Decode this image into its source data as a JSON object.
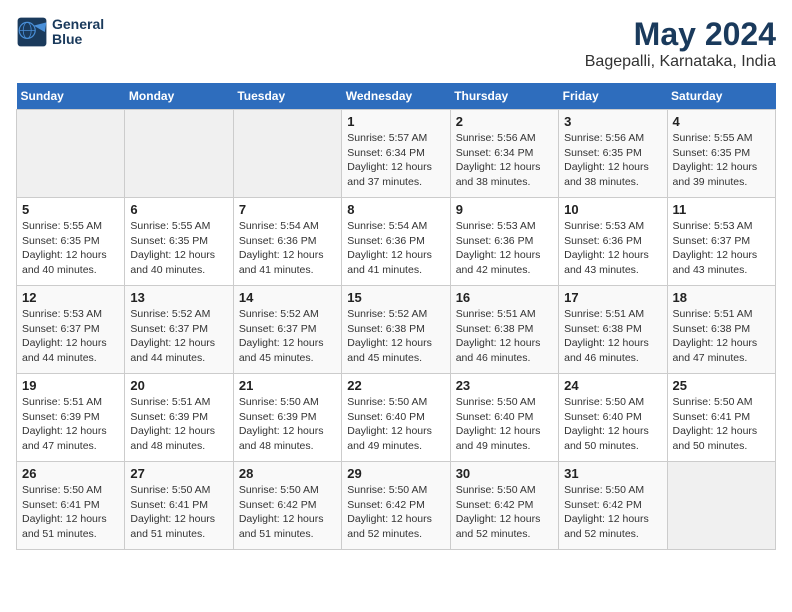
{
  "header": {
    "logo_line1": "General",
    "logo_line2": "Blue",
    "title": "May 2024",
    "subtitle": "Bagepalli, Karnataka, India"
  },
  "days_of_week": [
    "Sunday",
    "Monday",
    "Tuesday",
    "Wednesday",
    "Thursday",
    "Friday",
    "Saturday"
  ],
  "weeks": [
    [
      {
        "num": "",
        "info": ""
      },
      {
        "num": "",
        "info": ""
      },
      {
        "num": "",
        "info": ""
      },
      {
        "num": "1",
        "info": "Sunrise: 5:57 AM\nSunset: 6:34 PM\nDaylight: 12 hours and 37 minutes."
      },
      {
        "num": "2",
        "info": "Sunrise: 5:56 AM\nSunset: 6:34 PM\nDaylight: 12 hours and 38 minutes."
      },
      {
        "num": "3",
        "info": "Sunrise: 5:56 AM\nSunset: 6:35 PM\nDaylight: 12 hours and 38 minutes."
      },
      {
        "num": "4",
        "info": "Sunrise: 5:55 AM\nSunset: 6:35 PM\nDaylight: 12 hours and 39 minutes."
      }
    ],
    [
      {
        "num": "5",
        "info": "Sunrise: 5:55 AM\nSunset: 6:35 PM\nDaylight: 12 hours and 40 minutes."
      },
      {
        "num": "6",
        "info": "Sunrise: 5:55 AM\nSunset: 6:35 PM\nDaylight: 12 hours and 40 minutes."
      },
      {
        "num": "7",
        "info": "Sunrise: 5:54 AM\nSunset: 6:36 PM\nDaylight: 12 hours and 41 minutes."
      },
      {
        "num": "8",
        "info": "Sunrise: 5:54 AM\nSunset: 6:36 PM\nDaylight: 12 hours and 41 minutes."
      },
      {
        "num": "9",
        "info": "Sunrise: 5:53 AM\nSunset: 6:36 PM\nDaylight: 12 hours and 42 minutes."
      },
      {
        "num": "10",
        "info": "Sunrise: 5:53 AM\nSunset: 6:36 PM\nDaylight: 12 hours and 43 minutes."
      },
      {
        "num": "11",
        "info": "Sunrise: 5:53 AM\nSunset: 6:37 PM\nDaylight: 12 hours and 43 minutes."
      }
    ],
    [
      {
        "num": "12",
        "info": "Sunrise: 5:53 AM\nSunset: 6:37 PM\nDaylight: 12 hours and 44 minutes."
      },
      {
        "num": "13",
        "info": "Sunrise: 5:52 AM\nSunset: 6:37 PM\nDaylight: 12 hours and 44 minutes."
      },
      {
        "num": "14",
        "info": "Sunrise: 5:52 AM\nSunset: 6:37 PM\nDaylight: 12 hours and 45 minutes."
      },
      {
        "num": "15",
        "info": "Sunrise: 5:52 AM\nSunset: 6:38 PM\nDaylight: 12 hours and 45 minutes."
      },
      {
        "num": "16",
        "info": "Sunrise: 5:51 AM\nSunset: 6:38 PM\nDaylight: 12 hours and 46 minutes."
      },
      {
        "num": "17",
        "info": "Sunrise: 5:51 AM\nSunset: 6:38 PM\nDaylight: 12 hours and 46 minutes."
      },
      {
        "num": "18",
        "info": "Sunrise: 5:51 AM\nSunset: 6:38 PM\nDaylight: 12 hours and 47 minutes."
      }
    ],
    [
      {
        "num": "19",
        "info": "Sunrise: 5:51 AM\nSunset: 6:39 PM\nDaylight: 12 hours and 47 minutes."
      },
      {
        "num": "20",
        "info": "Sunrise: 5:51 AM\nSunset: 6:39 PM\nDaylight: 12 hours and 48 minutes."
      },
      {
        "num": "21",
        "info": "Sunrise: 5:50 AM\nSunset: 6:39 PM\nDaylight: 12 hours and 48 minutes."
      },
      {
        "num": "22",
        "info": "Sunrise: 5:50 AM\nSunset: 6:40 PM\nDaylight: 12 hours and 49 minutes."
      },
      {
        "num": "23",
        "info": "Sunrise: 5:50 AM\nSunset: 6:40 PM\nDaylight: 12 hours and 49 minutes."
      },
      {
        "num": "24",
        "info": "Sunrise: 5:50 AM\nSunset: 6:40 PM\nDaylight: 12 hours and 50 minutes."
      },
      {
        "num": "25",
        "info": "Sunrise: 5:50 AM\nSunset: 6:41 PM\nDaylight: 12 hours and 50 minutes."
      }
    ],
    [
      {
        "num": "26",
        "info": "Sunrise: 5:50 AM\nSunset: 6:41 PM\nDaylight: 12 hours and 51 minutes."
      },
      {
        "num": "27",
        "info": "Sunrise: 5:50 AM\nSunset: 6:41 PM\nDaylight: 12 hours and 51 minutes."
      },
      {
        "num": "28",
        "info": "Sunrise: 5:50 AM\nSunset: 6:42 PM\nDaylight: 12 hours and 51 minutes."
      },
      {
        "num": "29",
        "info": "Sunrise: 5:50 AM\nSunset: 6:42 PM\nDaylight: 12 hours and 52 minutes."
      },
      {
        "num": "30",
        "info": "Sunrise: 5:50 AM\nSunset: 6:42 PM\nDaylight: 12 hours and 52 minutes."
      },
      {
        "num": "31",
        "info": "Sunrise: 5:50 AM\nSunset: 6:42 PM\nDaylight: 12 hours and 52 minutes."
      },
      {
        "num": "",
        "info": ""
      }
    ]
  ]
}
